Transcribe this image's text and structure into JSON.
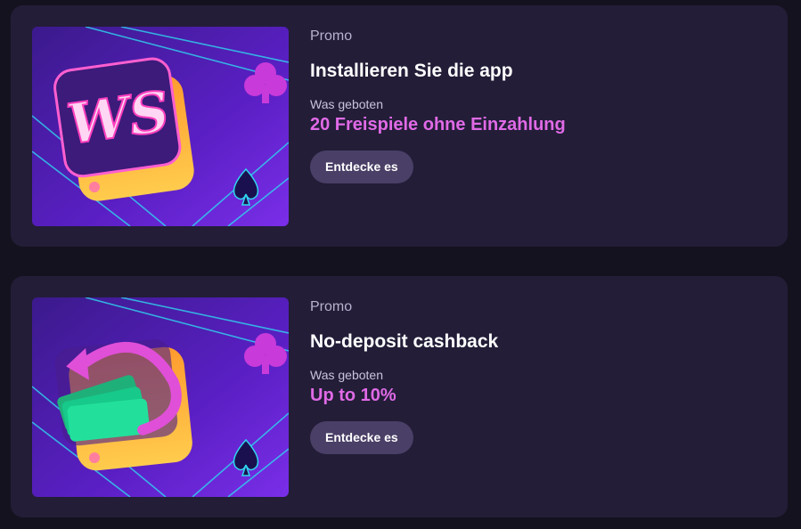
{
  "promos": [
    {
      "tag": "Promo",
      "title": "Installieren Sie die app",
      "offer_label": "Was geboten",
      "offer_value": "20 Freispiele ohne Einzahlung",
      "cta_label": "Entdecke es",
      "image_icon": "ws-logo-icon",
      "image_text": "WS"
    },
    {
      "tag": "Promo",
      "title": "No-deposit cashback",
      "offer_label": "Was geboten",
      "offer_value": "Up to 10%",
      "cta_label": "Entdecke es",
      "image_icon": "cashback-icon"
    }
  ],
  "colors": {
    "page_bg": "#15121f",
    "card_bg": "#231d38",
    "accent": "#e06ae6",
    "button_bg": "#4a3f66"
  }
}
